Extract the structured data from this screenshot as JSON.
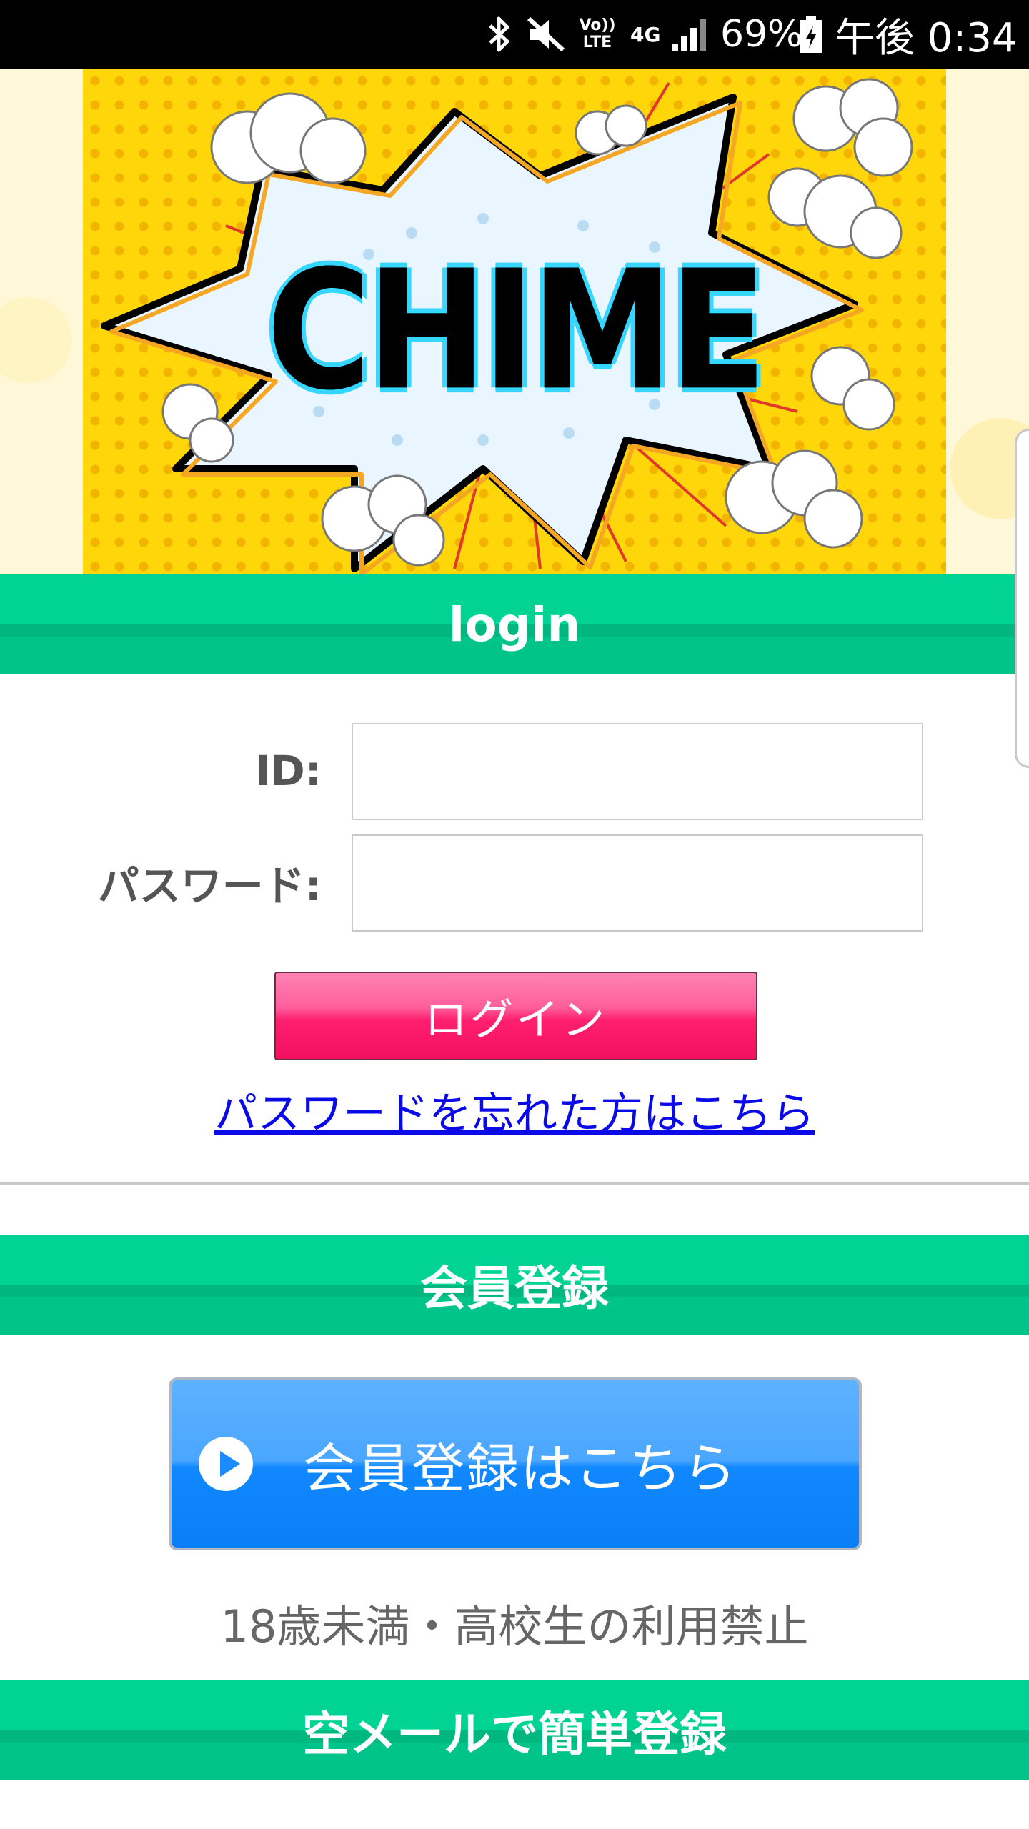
{
  "status_bar": {
    "icons": [
      "bluetooth-icon",
      "mute-icon",
      "volte-icon",
      "4g-icon",
      "signal-icon",
      "battery-icon"
    ],
    "volte_label": "Vo)) LTE",
    "network_label": "4G",
    "battery_percent": "69%",
    "clock": "午後 0:34"
  },
  "banner": {
    "logo_text": "CHIME",
    "colors": {
      "background": "#ffd60a",
      "burst_outline": "#f5a623",
      "text_outline": "#35d6ff"
    }
  },
  "login_section": {
    "title": "login",
    "id_label": "ID:",
    "id_value": "",
    "password_label": "パスワード:",
    "password_value": "",
    "login_button": "ログイン",
    "forgot_link": "パスワードを忘れた方はこちら"
  },
  "member_section": {
    "title": "会員登録",
    "register_button": "会員登録はこちら",
    "age_notice": "18歳未満・高校生の利用禁止"
  },
  "email_section": {
    "title": "空メールで簡単登録"
  },
  "colors": {
    "section_green": "#00d393",
    "login_pink": "#ff1f6f",
    "register_blue": "#1188ff",
    "link_blue": "#0a0ae6"
  }
}
